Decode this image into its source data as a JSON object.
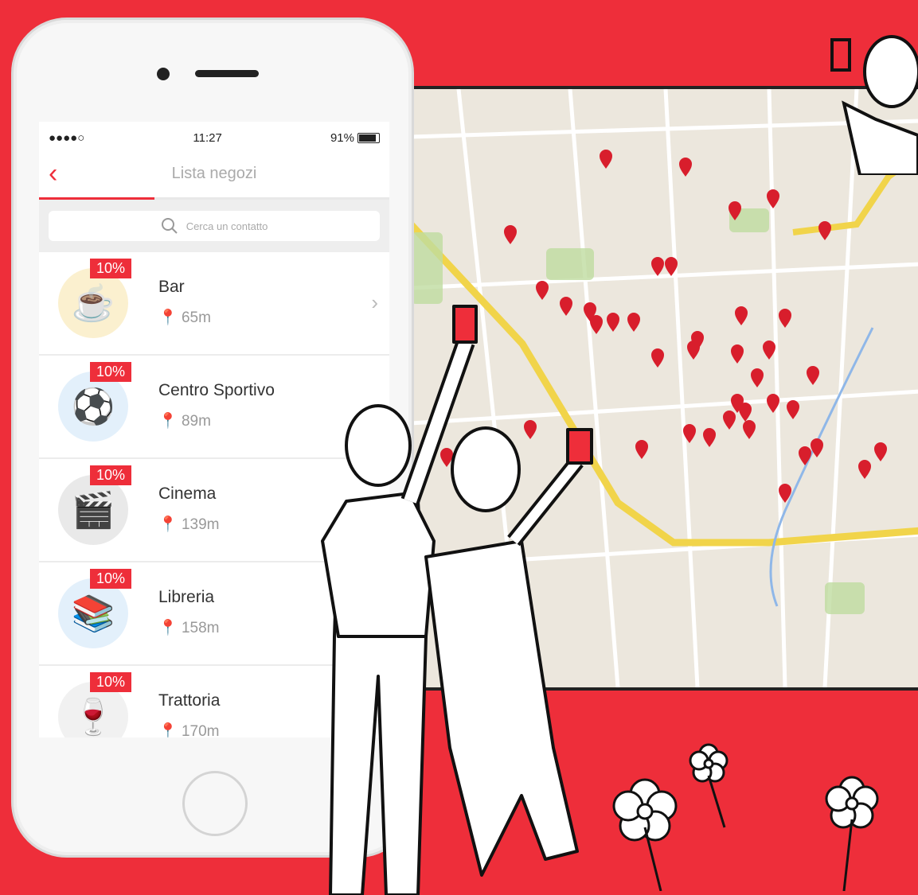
{
  "status": {
    "signal": "●●●●○",
    "time": "11:27",
    "battery": "91%"
  },
  "nav": {
    "title": "Lista negozi",
    "back": "‹"
  },
  "search": {
    "placeholder": "Cerca un contatto"
  },
  "shops": [
    {
      "badge": "10%",
      "name": "Bar",
      "distance": "65m",
      "icon": "coffee-icon"
    },
    {
      "badge": "10%",
      "name": "Centro Sportivo",
      "distance": "89m",
      "icon": "soccer-ball-icon"
    },
    {
      "badge": "10%",
      "name": "Cinema",
      "distance": "139m",
      "icon": "clapperboard-icon"
    },
    {
      "badge": "10%",
      "name": "Libreria",
      "distance": "158m",
      "icon": "library-icon"
    },
    {
      "badge": "10%",
      "name": "Trattoria",
      "distance": "170m",
      "icon": "wine-icon"
    }
  ],
  "colors": {
    "accent": "#ee2e3a",
    "map_bg": "#ece7dd",
    "road": "#f1d44a"
  }
}
